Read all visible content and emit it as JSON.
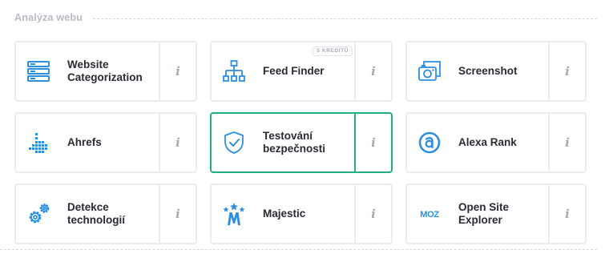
{
  "section": {
    "title": "Analýza webu"
  },
  "info_glyph": "i",
  "colors": {
    "icon_blue": "#2d8fe0",
    "active_border": "#21b27c",
    "card_border": "#ececef"
  },
  "cards": [
    {
      "label": "Website Categorization",
      "icon": "server-stack-icon"
    },
    {
      "label": "Feed Finder",
      "icon": "sitemap-icon",
      "badge": "5 KREDITŮ"
    },
    {
      "label": "Screenshot",
      "icon": "screenshot-camera-icon"
    },
    {
      "label": "Ahrefs",
      "icon": "ahrefs-logo-icon"
    },
    {
      "label": "Testování bezpečnosti",
      "icon": "shield-check-icon",
      "active": true
    },
    {
      "label": "Alexa Rank",
      "icon": "alexa-logo-icon"
    },
    {
      "label": "Detekce technologií",
      "icon": "gears-icon"
    },
    {
      "label": "Majestic",
      "icon": "majestic-logo-icon"
    },
    {
      "label": "Open Site Explorer",
      "icon": "moz-logo-icon",
      "logo_text": "MOZ"
    }
  ]
}
